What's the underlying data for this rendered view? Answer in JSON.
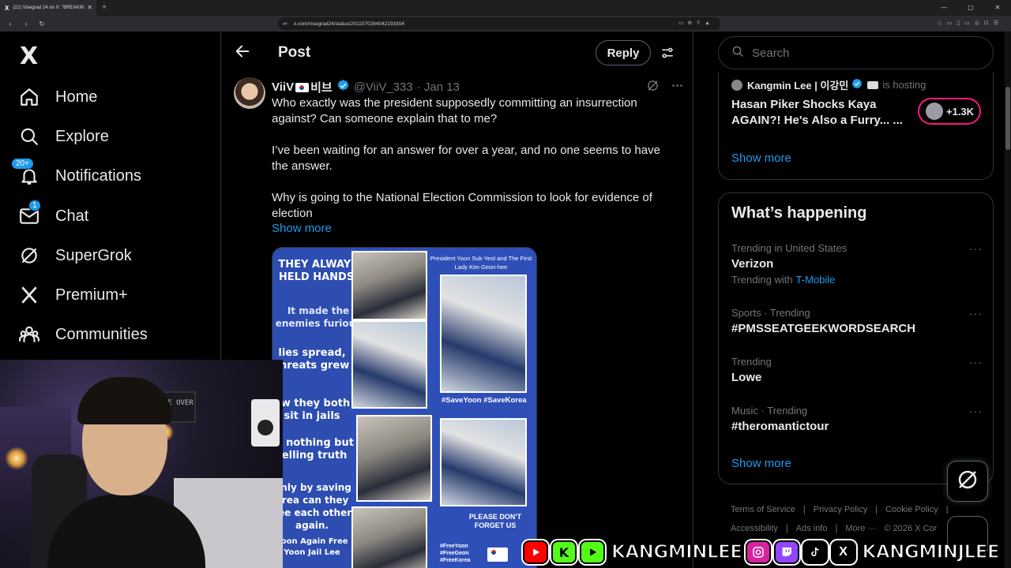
{
  "browser": {
    "tab_title": "(22) Visegrad 24 on X: \"BREAKIN",
    "tab_favicon": "X",
    "url": "x.com/visegrad24/status/2011070264042193304",
    "new_tab": "+"
  },
  "nav": {
    "logo": "X",
    "items": [
      {
        "label": "Home",
        "icon": "home-icon"
      },
      {
        "label": "Explore",
        "icon": "search-icon"
      },
      {
        "label": "Notifications",
        "icon": "bell-icon",
        "badge": "20+"
      },
      {
        "label": "Chat",
        "icon": "mail-icon",
        "badge": "1"
      },
      {
        "label": "SuperGrok",
        "icon": "grok-icon"
      },
      {
        "label": "Premium+",
        "icon": "x-icon"
      },
      {
        "label": "Communities",
        "icon": "people-icon"
      }
    ]
  },
  "header": {
    "title": "Post",
    "reply_label": "Reply"
  },
  "post": {
    "display_name": "ViiV",
    "display_name_suffix": "비브",
    "handle": "@ViiV_333",
    "date": "· Jan 13",
    "paragraphs": [
      "Who exactly was the president supposedly committing an insurrection against? Can someone explain that to me?",
      "I’ve been waiting for an answer for over a year, and no one seems to have the answer.",
      "Why is going to the National Election Commission to look for evidence of election"
    ],
    "show_more": "Show more",
    "image": {
      "header": "President Yoon Suk-Yeol and The First Lady Kim Geon-hee",
      "lines_left": [
        "THEY ALWAYS HELD HANDS.",
        "It made the enemies furious",
        "lies spread, threats grew",
        "ow they both sit in jails",
        "or nothing but telling truth",
        "Only by saving orea can they see each other again.",
        "Yoon Again Free Yoon Jail Lee"
      ],
      "tags_mid": "#SaveYoon #SaveKorea",
      "tags_bottom": "#FreeYoon #FreeGeon #FreeKorea",
      "please": "PLEASE DON'T FORGET US"
    }
  },
  "search": {
    "placeholder": "Search"
  },
  "space": {
    "host_name": "Kangmin Lee | 이강민",
    "hosting": "is hosting",
    "title": "Hasan Piker Shocks Kaya AGAIN?! He's Also a Furry... ...",
    "listeners": "+1.3K",
    "show_more": "Show more"
  },
  "happening": {
    "title": "What’s happening",
    "trends": [
      {
        "context": "Trending in United States",
        "name": "Verizon",
        "with_label": "Trending with",
        "with_link": "T-Mobile"
      },
      {
        "context": "Sports · Trending",
        "name": "#PMSSEATGEEKWORDSEARCH"
      },
      {
        "context": "Trending",
        "name": "Lowe"
      },
      {
        "context": "Music · Trending",
        "name": "#theromantictour"
      }
    ],
    "more_glyph": "···",
    "show_more": "Show more"
  },
  "footer": {
    "links": [
      "Terms of Service",
      "|",
      "Privacy Policy",
      "|",
      "Cookie Policy",
      "|",
      "Accessibility",
      "|",
      "Ads info",
      "|",
      "More ···",
      "© 2026 X Cor"
    ]
  },
  "webcam": {
    "sign": "GAME OVER"
  },
  "banner": {
    "k_letter": "K",
    "name1": "KANGMINLEE",
    "x_letter": "X",
    "name2": "KANGMINJLEE"
  },
  "colors": {
    "accent": "#1d9bf0",
    "pink": "#f91880",
    "youtube": "#ff0000",
    "kick": "#53fc18",
    "twitch": "#9146ff",
    "instagram": "#d6249f"
  }
}
